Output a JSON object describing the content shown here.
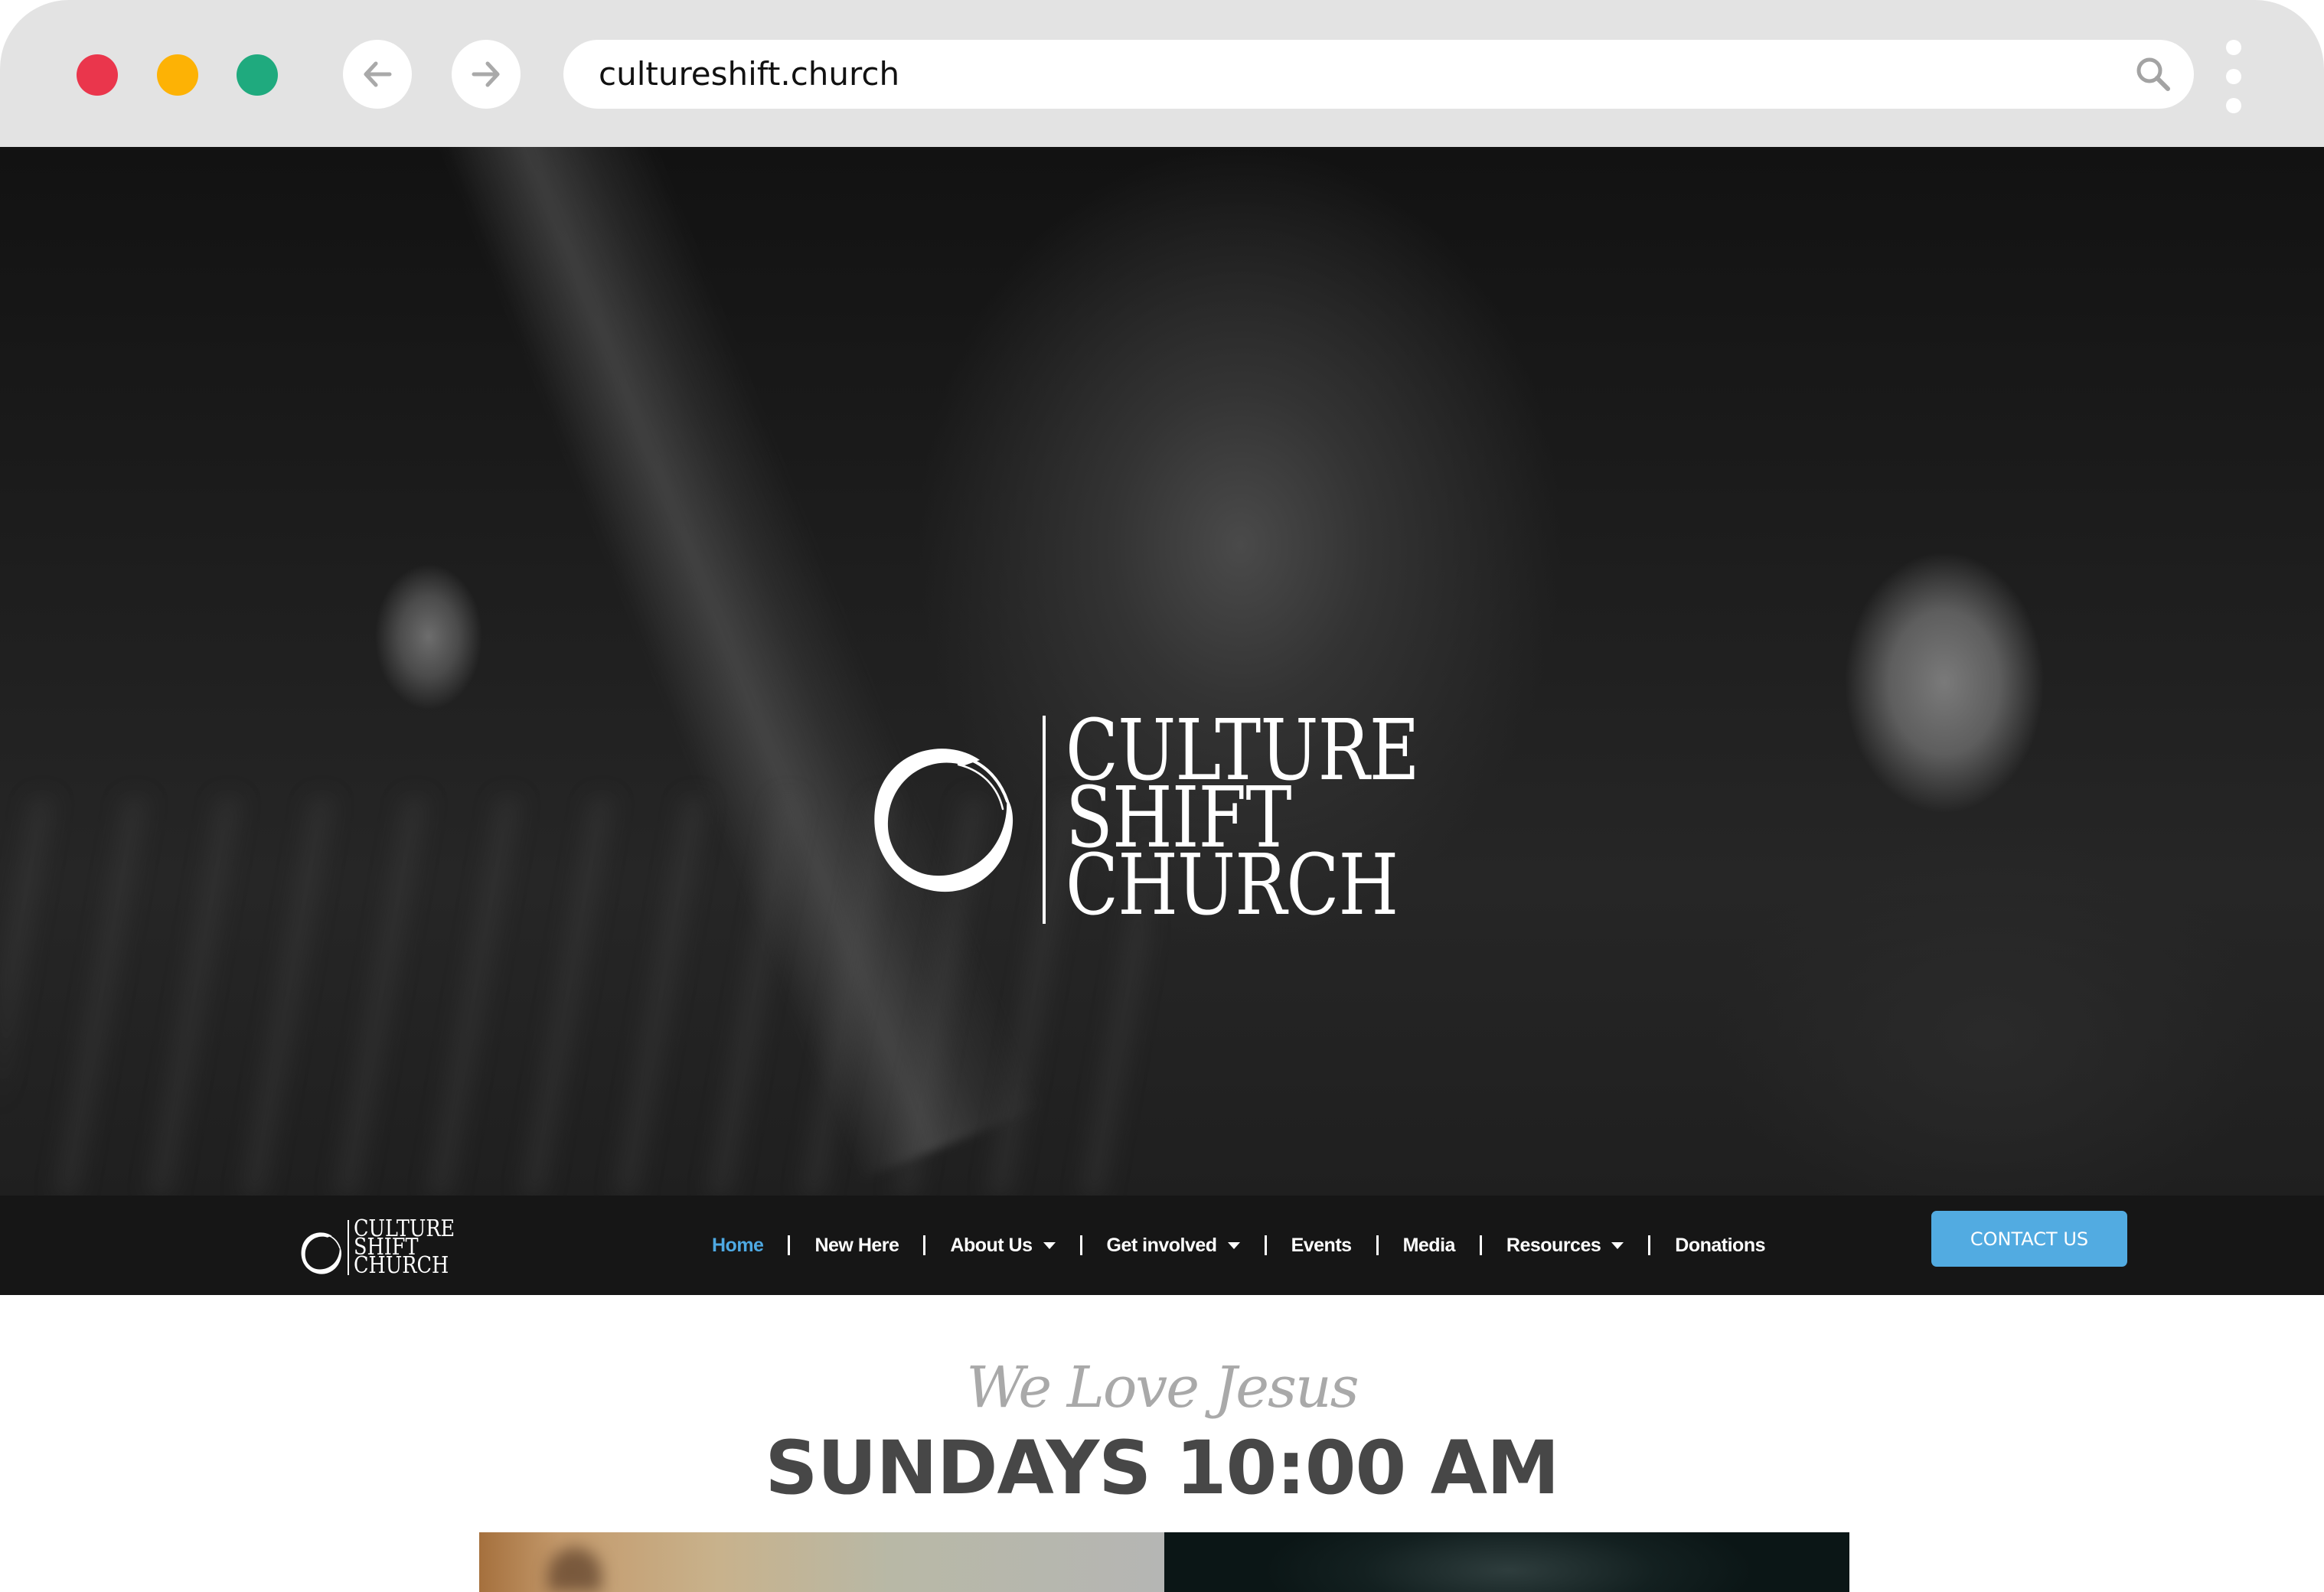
{
  "browser": {
    "url": "cultureshift.church",
    "window_controls": [
      "close",
      "minimize",
      "maximize"
    ],
    "colors": {
      "close": "#ea364c",
      "minimize": "#fdb205",
      "maximize": "#1faa7e",
      "chrome_bg": "#e3e3e3"
    },
    "icons": {
      "back": "arrow-left-icon",
      "forward": "arrow-right-icon",
      "search": "search-icon",
      "menu": "kebab-menu-icon"
    }
  },
  "hero": {
    "logo_lines": [
      "CULTURE",
      "SHIFT",
      "CHURCH"
    ],
    "logo_icon": "brush-circle-icon"
  },
  "navbar": {
    "logo_lines": [
      "CULTURE",
      "SHIFT",
      "CHURCH"
    ],
    "items": [
      {
        "label": "Home",
        "active": true,
        "dropdown": false
      },
      {
        "label": "New Here",
        "active": false,
        "dropdown": false
      },
      {
        "label": "About Us",
        "active": false,
        "dropdown": true
      },
      {
        "label": "Get involved",
        "active": false,
        "dropdown": true
      },
      {
        "label": "Events",
        "active": false,
        "dropdown": false
      },
      {
        "label": "Media",
        "active": false,
        "dropdown": false
      },
      {
        "label": "Resources",
        "active": false,
        "dropdown": true
      },
      {
        "label": "Donations",
        "active": false,
        "dropdown": false
      }
    ],
    "cta_label": "CONTACT US",
    "colors": {
      "background": "#161616",
      "active": "#4ea9e3",
      "cta": "#52abe1"
    }
  },
  "content": {
    "tagline": "We Love Jesus",
    "service_time": "SUNDAYS 10:00 AM"
  }
}
